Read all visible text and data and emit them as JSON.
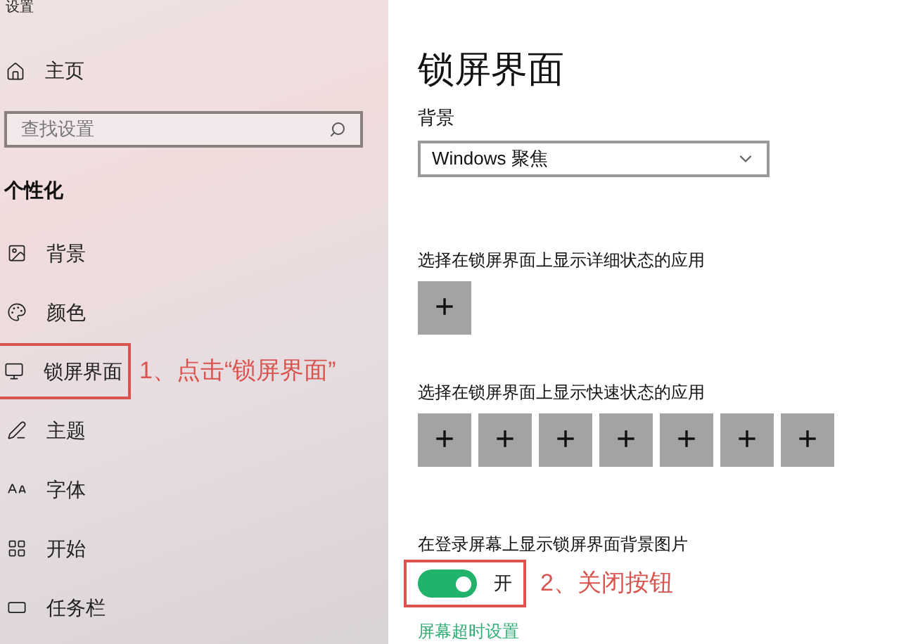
{
  "window": {
    "title": "设置"
  },
  "sidebar": {
    "home": {
      "label": "主页"
    },
    "search": {
      "placeholder": "查找设置"
    },
    "section": "个性化",
    "items": [
      {
        "label": "背景",
        "kind": "image",
        "annotated": false
      },
      {
        "label": "颜色",
        "kind": "palette",
        "annotated": false
      },
      {
        "label": "锁屏界面",
        "kind": "lockscreen",
        "annotated": true,
        "callout": "1、点击“锁屏界面”"
      },
      {
        "label": "主题",
        "kind": "theme",
        "annotated": false
      },
      {
        "label": "字体",
        "kind": "font",
        "annotated": false
      },
      {
        "label": "开始",
        "kind": "start",
        "annotated": false
      },
      {
        "label": "任务栏",
        "kind": "taskbar",
        "annotated": false
      }
    ]
  },
  "page": {
    "title": "锁屏界面",
    "background": {
      "label": "背景",
      "value": "Windows 聚焦"
    },
    "detailed_apps": {
      "label": "选择在锁屏界面上显示详细状态的应用",
      "slots": [
        "+"
      ]
    },
    "quick_apps": {
      "label": "选择在锁屏界面上显示快速状态的应用",
      "slots": [
        "+",
        "+",
        "+",
        "+",
        "+",
        "+",
        "+"
      ]
    },
    "signin_background": {
      "label": "在登录屏幕上显示锁屏界面背景图片",
      "on": true,
      "state_text": "开",
      "annotated": true,
      "callout": "2、关闭按钮"
    },
    "link": "屏幕超时设置"
  }
}
